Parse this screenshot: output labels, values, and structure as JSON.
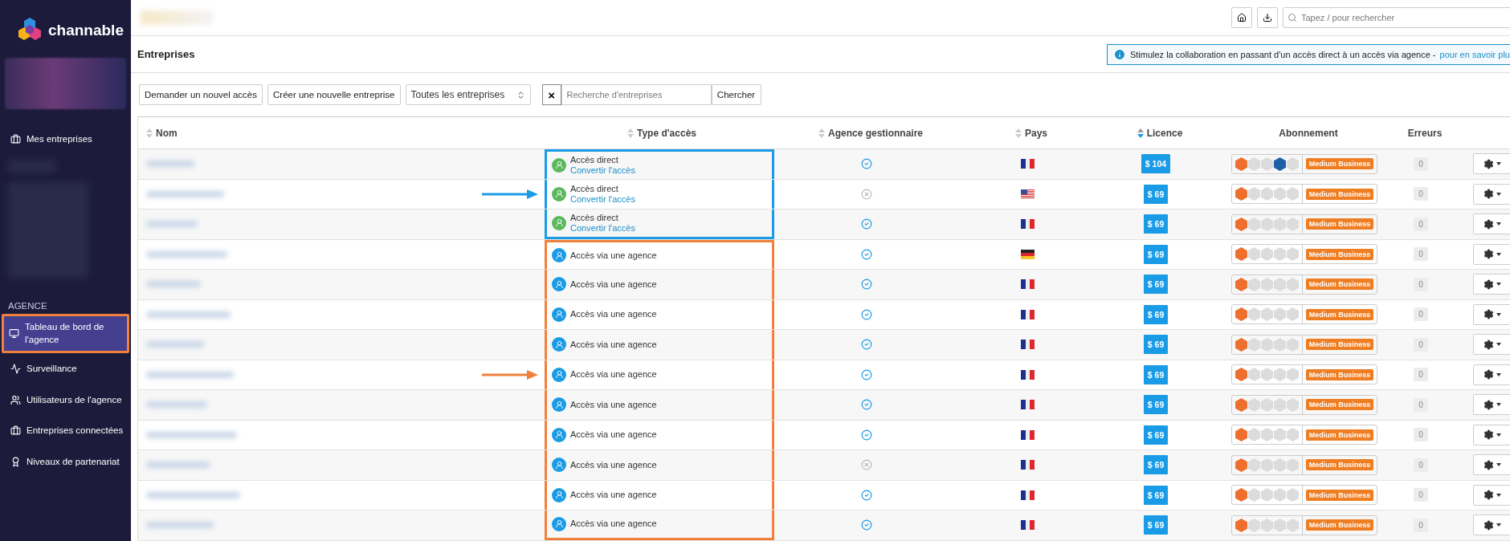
{
  "brand": {
    "name": "channable"
  },
  "sidebar": {
    "items": [
      {
        "label": "Mes entreprises",
        "selected": false,
        "highlighted": false
      }
    ],
    "section": "AGENCE",
    "agency_items": [
      {
        "label": "Tableau de bord de l'agence",
        "selected": true,
        "highlighted": true
      },
      {
        "label": "Surveillance",
        "selected": false,
        "highlighted": false
      },
      {
        "label": "Utilisateurs de l'agence",
        "selected": false,
        "highlighted": false
      },
      {
        "label": "Entreprises connectées",
        "selected": false,
        "highlighted": false
      },
      {
        "label": "Niveaux de partenariat",
        "selected": false,
        "highlighted": false
      }
    ]
  },
  "topbar": {
    "search": {
      "placeholder": "Tapez / pour rechercher"
    }
  },
  "page": {
    "title": "Entreprises",
    "banner": {
      "text": "Stimulez la collaboration en passant d'un accès direct à un accès via agence - ",
      "link": "pour en savoir plu"
    }
  },
  "toolbar": {
    "buttons": [
      "Demander un nouvel accès",
      "Créer une nouvelle entreprise"
    ],
    "filter": "Toutes les entreprises",
    "clear": "×",
    "search": {
      "placeholder": "Recherche d'entreprises"
    },
    "search_button": "Chercher"
  },
  "table": {
    "columns": [
      {
        "label": "Nom",
        "sortable": true,
        "sorted": false
      },
      {
        "label": "Type d'accès",
        "sortable": true,
        "sorted": false
      },
      {
        "label": "Agence gestionnaire",
        "sortable": true,
        "sorted": false
      },
      {
        "label": "Pays",
        "sortable": true,
        "sorted": false
      },
      {
        "label": "Licence",
        "sortable": true,
        "sorted": true
      },
      {
        "label": "Abonnement",
        "sortable": false
      },
      {
        "label": "Erreurs",
        "sortable": false
      }
    ],
    "highlight_boxes": [
      {
        "color": "#1a9be6"
      },
      {
        "color": "#f0803c"
      }
    ],
    "rows": [
      {
        "kind": "direct",
        "access_label": "Accès direct",
        "convert_link": "Convertir l'accès",
        "managed": true,
        "flag": {
          "kind": "fr"
        },
        "licence": "$ 104",
        "features": [
          true,
          false,
          false,
          true,
          false
        ],
        "plan": "Medium Business",
        "errors": "0",
        "arrow": false
      },
      {
        "kind": "direct",
        "access_label": "Accès direct",
        "convert_link": "Convertir l'accès",
        "managed": false,
        "flag": {
          "kind": "us"
        },
        "licence": "$ 69",
        "features": [
          true,
          false,
          false,
          false,
          false
        ],
        "plan": "Medium Business",
        "errors": "0",
        "arrow": true
      },
      {
        "kind": "direct",
        "access_label": "Accès direct",
        "convert_link": "Convertir l'accès",
        "managed": true,
        "flag": {
          "kind": "fr"
        },
        "licence": "$ 69",
        "features": [
          true,
          false,
          false,
          false,
          false
        ],
        "plan": "Medium Business",
        "errors": "0",
        "arrow": false
      },
      {
        "kind": "agency",
        "access_label": "Accès via une agence",
        "managed": true,
        "flag": {
          "kind": "de"
        },
        "licence": "$ 69",
        "features": [
          true,
          false,
          false,
          false,
          false
        ],
        "plan": "Medium Business",
        "errors": "0",
        "arrow": false
      },
      {
        "kind": "agency",
        "access_label": "Accès via une agence",
        "managed": true,
        "flag": {
          "kind": "fr"
        },
        "licence": "$ 69",
        "features": [
          true,
          false,
          false,
          false,
          false
        ],
        "plan": "Medium Business",
        "errors": "0",
        "arrow": false
      },
      {
        "kind": "agency",
        "access_label": "Accès via une agence",
        "managed": true,
        "flag": {
          "kind": "fr"
        },
        "licence": "$ 69",
        "features": [
          true,
          false,
          false,
          false,
          false
        ],
        "plan": "Medium Business",
        "errors": "0",
        "arrow": false
      },
      {
        "kind": "agency",
        "access_label": "Accès via une agence",
        "managed": true,
        "flag": {
          "kind": "fr"
        },
        "licence": "$ 69",
        "features": [
          true,
          false,
          false,
          false,
          false
        ],
        "plan": "Medium Business",
        "errors": "0",
        "arrow": false
      },
      {
        "kind": "agency",
        "access_label": "Accès via une agence",
        "managed": true,
        "flag": {
          "kind": "fr"
        },
        "licence": "$ 69",
        "features": [
          true,
          false,
          false,
          false,
          false
        ],
        "plan": "Medium Business",
        "errors": "0",
        "arrow": true
      },
      {
        "kind": "agency",
        "access_label": "Accès via une agence",
        "managed": true,
        "flag": {
          "kind": "fr"
        },
        "licence": "$ 69",
        "features": [
          true,
          false,
          false,
          false,
          false
        ],
        "plan": "Medium Business",
        "errors": "0",
        "arrow": false
      },
      {
        "kind": "agency",
        "access_label": "Accès via une agence",
        "managed": true,
        "flag": {
          "kind": "fr"
        },
        "licence": "$ 69",
        "features": [
          true,
          false,
          false,
          false,
          false
        ],
        "plan": "Medium Business",
        "errors": "0",
        "arrow": false
      },
      {
        "kind": "agency",
        "access_label": "Accès via une agence",
        "managed": false,
        "flag": {
          "kind": "fr"
        },
        "licence": "$ 69",
        "features": [
          true,
          false,
          false,
          false,
          false
        ],
        "plan": "Medium Business",
        "errors": "0",
        "arrow": false
      },
      {
        "kind": "agency",
        "access_label": "Accès via une agence",
        "managed": true,
        "flag": {
          "kind": "fr"
        },
        "licence": "$ 69",
        "features": [
          true,
          false,
          false,
          false,
          false
        ],
        "plan": "Medium Business",
        "errors": "0",
        "arrow": false
      },
      {
        "kind": "agency",
        "access_label": "Accès via une agence",
        "managed": true,
        "flag": {
          "kind": "fr"
        },
        "licence": "$ 69",
        "features": [
          true,
          false,
          false,
          false,
          false
        ],
        "plan": "Medium Business",
        "errors": "0",
        "arrow": false
      }
    ]
  }
}
